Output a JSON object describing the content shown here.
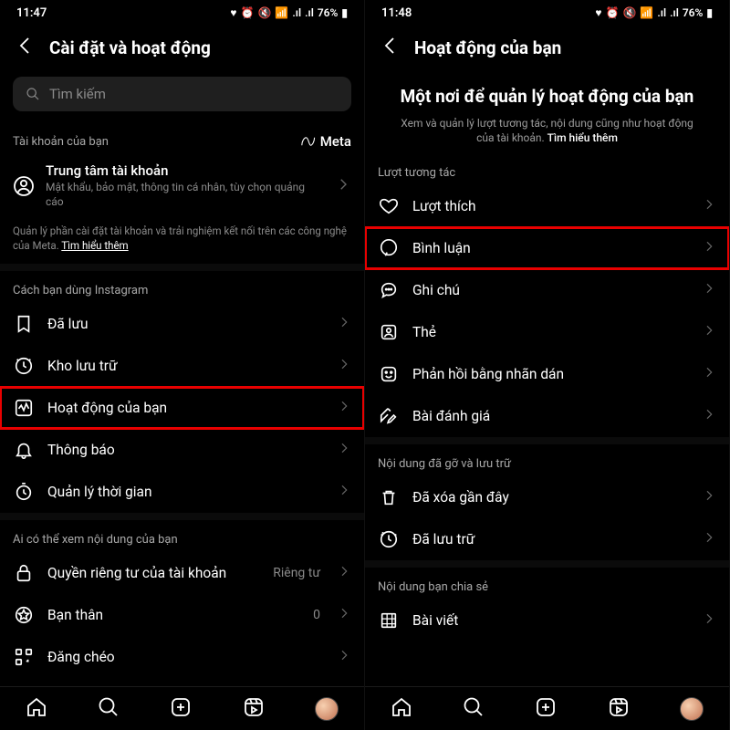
{
  "left": {
    "status_time": "11:47",
    "status_batt": "76%",
    "header_title": "Cài đặt và hoạt động",
    "search_placeholder": "Tìm kiếm",
    "account_section": "Tài khoản của bạn",
    "meta_brand": "Meta",
    "account_center_title": "Trung tâm tài khoản",
    "account_center_sub": "Mật khẩu, bảo mật, thông tin cá nhân, tùy chọn quảng cáo",
    "meta_desc_pre": "Quản lý phần cài đặt tài khoản và trải nghiệm kết nối trên các công nghệ của Meta. ",
    "meta_desc_link": "Tìm hiểu thêm",
    "section_usage": "Cách bạn dùng Instagram",
    "rows_usage": [
      {
        "label": "Đã lưu"
      },
      {
        "label": "Kho lưu trữ"
      },
      {
        "label": "Hoạt động của bạn",
        "highlight": true
      },
      {
        "label": "Thông báo"
      },
      {
        "label": "Quản lý thời gian"
      }
    ],
    "section_visibility": "Ai có thể xem nội dung của bạn",
    "rows_visibility": [
      {
        "label": "Quyền riêng tư của tài khoản",
        "trail": "Riêng tư"
      },
      {
        "label": "Bạn thân",
        "trail": "0"
      },
      {
        "label": "Đăng chéo"
      }
    ]
  },
  "right": {
    "status_time": "11:48",
    "status_batt": "76%",
    "header_title": "Hoạt động của bạn",
    "hero_title": "Một nơi để quản lý hoạt động của bạn",
    "hero_sub_pre": "Xem và quản lý lượt tương tác, nội dung cũng như hoạt động của tài khoản. ",
    "hero_sub_link": "Tìm hiểu thêm",
    "section_interact": "Lượt tương tác",
    "rows_interact": [
      {
        "label": "Lượt thích"
      },
      {
        "label": "Bình luận",
        "highlight": true
      },
      {
        "label": "Ghi chú"
      },
      {
        "label": "Thẻ"
      },
      {
        "label": "Phản hồi bằng nhãn dán"
      },
      {
        "label": "Bài đánh giá"
      }
    ],
    "section_removed": "Nội dung đã gỡ và lưu trữ",
    "rows_removed": [
      {
        "label": "Đã xóa gần đây"
      },
      {
        "label": "Đã lưu trữ"
      }
    ],
    "section_shared": "Nội dung bạn chia sẻ",
    "rows_shared": [
      {
        "label": "Bài viết"
      }
    ]
  }
}
